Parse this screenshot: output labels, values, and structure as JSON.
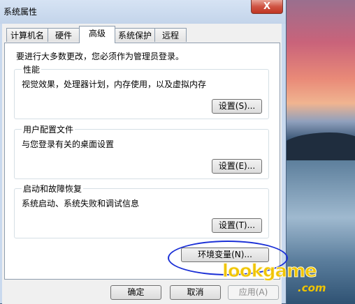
{
  "window": {
    "title": "系统属性",
    "close_symbol": "X"
  },
  "tabs": [
    {
      "label": "计算机名"
    },
    {
      "label": "硬件"
    },
    {
      "label": "高级"
    },
    {
      "label": "系统保护"
    },
    {
      "label": "远程"
    }
  ],
  "active_tab": "高级",
  "panel": {
    "intro": "要进行大多数更改，您必须作为管理员登录。",
    "groups": [
      {
        "title": "性能",
        "description": "视觉效果，处理器计划，内存使用，以及虚拟内存",
        "button": "设置(S)..."
      },
      {
        "title": "用户配置文件",
        "description": "与您登录有关的桌面设置",
        "button": "设置(E)..."
      },
      {
        "title": "启动和故障恢复",
        "description": "系统启动、系统失败和调试信息",
        "button": "设置(T)..."
      }
    ],
    "env_button": "环境变量(N)..."
  },
  "dialog_buttons": {
    "ok": "确定",
    "cancel": "取消",
    "apply": "应用(A)"
  },
  "watermark": {
    "main": "lookgame",
    "sub": ".com"
  },
  "colors": {
    "annotation_circle": "#1a2fd6",
    "watermark": "#f0c400"
  }
}
